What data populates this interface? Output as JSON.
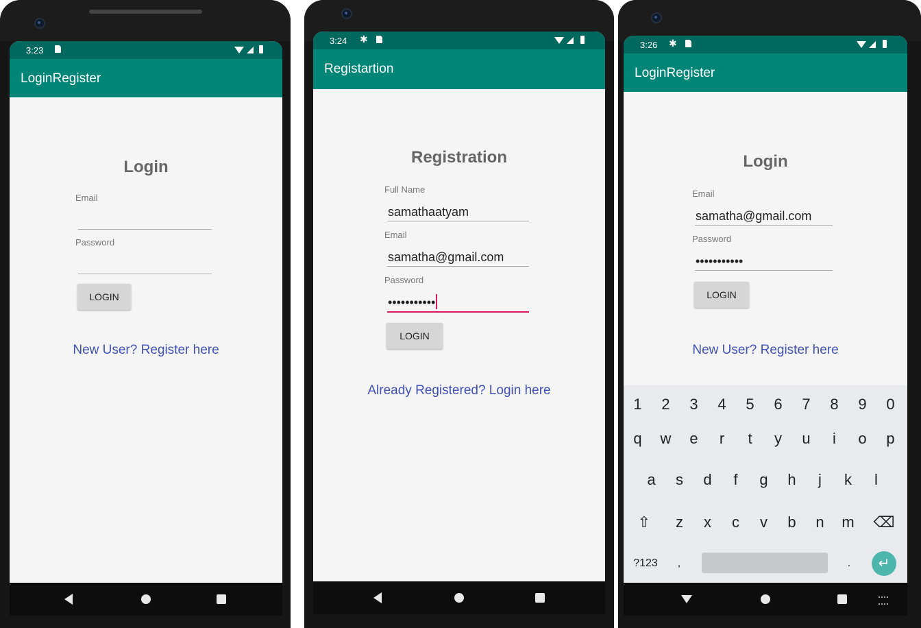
{
  "screens": [
    {
      "status_time": "3:23",
      "app_title": "LoginRegister",
      "heading": "Login",
      "email_label": "Email",
      "email_value": "",
      "password_label": "Password",
      "password_value": "",
      "button_label": "LOGIN",
      "link_text": "New User? Register here"
    },
    {
      "status_time": "3:24",
      "app_title": "Registartion",
      "heading": "Registration",
      "fullname_label": "Full Name",
      "fullname_value": "samathaatyam",
      "email_label": "Email",
      "email_value": "samatha@gmail.com",
      "password_label": "Password",
      "password_value": "•••••••••••",
      "button_label": "LOGIN",
      "link_text": "Already Registered? Login here"
    },
    {
      "status_time": "3:26",
      "app_title": "LoginRegister",
      "heading": "Login",
      "email_label": "Email",
      "email_value": "samatha@gmail.com",
      "password_label": "Password",
      "password_value": "•••••••••••",
      "button_label": "LOGIN",
      "link_text": "New User? Register here"
    }
  ],
  "keyboard": {
    "numbers": [
      "1",
      "2",
      "3",
      "4",
      "5",
      "6",
      "7",
      "8",
      "9",
      "0"
    ],
    "row1": [
      "q",
      "w",
      "e",
      "r",
      "t",
      "y",
      "u",
      "i",
      "o",
      "p"
    ],
    "row2": [
      "a",
      "s",
      "d",
      "f",
      "g",
      "h",
      "j",
      "k",
      "l"
    ],
    "row3": [
      "z",
      "x",
      "c",
      "v",
      "b",
      "n",
      "m"
    ],
    "symbols_key": "?123",
    "comma_key": ",",
    "period_key": ".",
    "shift_icon": "⇧",
    "backspace_icon": "⌫",
    "enter_icon": "↵"
  },
  "colors": {
    "appbar": "#008577",
    "statusbar": "#00695f",
    "link": "#3f51b5",
    "focus": "#d81b60",
    "enter_key": "#4db6ac"
  }
}
